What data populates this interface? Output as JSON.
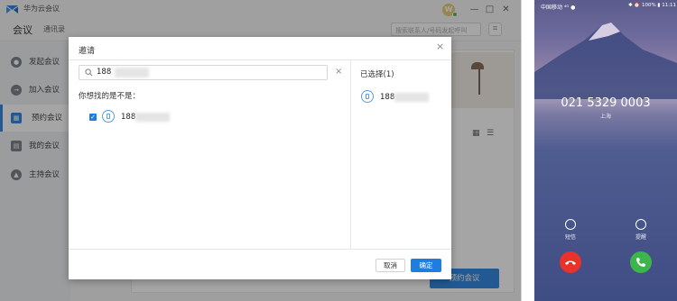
{
  "app": {
    "title": "华为云会议",
    "avatar_letter": "W",
    "window_controls": {
      "minimize": "—",
      "maximize": "□",
      "close": "✕"
    },
    "tabs": {
      "main": "会议",
      "sub": "通讯录"
    },
    "search_placeholder": "搜索联系人/号码发起呼叫",
    "sidebar": [
      {
        "label": "发起会议",
        "icon": "meeting-icon"
      },
      {
        "label": "加入会议",
        "icon": "join-icon"
      },
      {
        "label": "预约会议",
        "icon": "calendar-icon",
        "active": true
      },
      {
        "label": "我的会议",
        "icon": "my-meetings-icon"
      },
      {
        "label": "主持会议",
        "icon": "host-icon"
      }
    ],
    "schedule_button": "预约会议"
  },
  "dialog": {
    "title": "邀请",
    "close": "×",
    "search_value": "188",
    "clear": "×",
    "suggest_label": "你想找的是不是：",
    "results": [
      {
        "number": "188",
        "checked": true
      }
    ],
    "selected_title": "已选择(1)",
    "selected": [
      {
        "number": "188"
      }
    ],
    "cancel": "取消",
    "confirm": "确定"
  },
  "phone": {
    "status_left": "中国移动 ⁴ᴳ ●",
    "status_right": "✱ ⏰ 100% ▮ 11:11",
    "caller_number": "021 5329 0003",
    "caller_location": "上海",
    "actions": [
      {
        "label": "短信",
        "icon": "message-icon"
      },
      {
        "label": "提醒",
        "icon": "alarm-icon"
      }
    ]
  },
  "colors": {
    "accent": "#1e7de0",
    "decline": "#e8322c",
    "accept": "#3cb54a"
  }
}
